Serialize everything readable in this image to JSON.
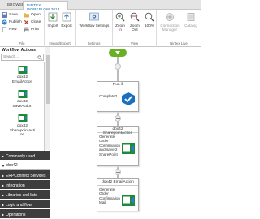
{
  "tabs": {
    "browse": "BROWSE",
    "active": "NINTEX WORKFLOW 2013"
  },
  "ribbon": {
    "file": {
      "label": "File",
      "save": "Save",
      "publish": "Publish",
      "new": "New",
      "open": "Open",
      "close": "Close",
      "print": "Print"
    },
    "import_export": {
      "label": "Import/Export",
      "import": "Import",
      "export": "Export"
    },
    "settings": {
      "label": "Settings",
      "workflow_settings": "Workflow Settings"
    },
    "view": {
      "label": "View",
      "zoom_in": "Zoom In",
      "zoom_out": "Zoom Out",
      "zoom_level": "100%"
    },
    "nintex_live": {
      "label": "Nintex Live",
      "connection_manager": "Connection Manager",
      "catalog": "Catalog"
    }
  },
  "left_panel": {
    "title": "Workflow Actions",
    "search_placeholder": "Search...",
    "actions": [
      {
        "line1": "dox42",
        "line2": "EmailAction",
        "line3": ""
      },
      {
        "line1": "dox42",
        "line2": "SaveAction",
        "line3": ""
      },
      {
        "line1": "dox42",
        "line2": "SharepointActi",
        "line3": "on"
      }
    ],
    "categories": [
      "Commonly used",
      "dox42",
      "ERPConnect Services",
      "Integration",
      "Libraries and lists",
      "Logic and flow",
      "Operations"
    ]
  },
  "canvas": {
    "run_if": {
      "title": "Run if",
      "text": "Complete?"
    },
    "sharepoint_action": {
      "title": "dox42 SharepointAction",
      "lines": [
        "Generate",
        "Order",
        "Confirmation",
        "and save 2",
        "SharePoint"
      ]
    },
    "email_action": {
      "title": "dox42 EmailAction",
      "lines": [
        "Generate",
        "Order",
        "Confirmation",
        "Mail"
      ]
    }
  },
  "colors": {
    "accent": "#0f6db2",
    "start": "#6ab023",
    "category_bg": "#3d3d3d"
  }
}
